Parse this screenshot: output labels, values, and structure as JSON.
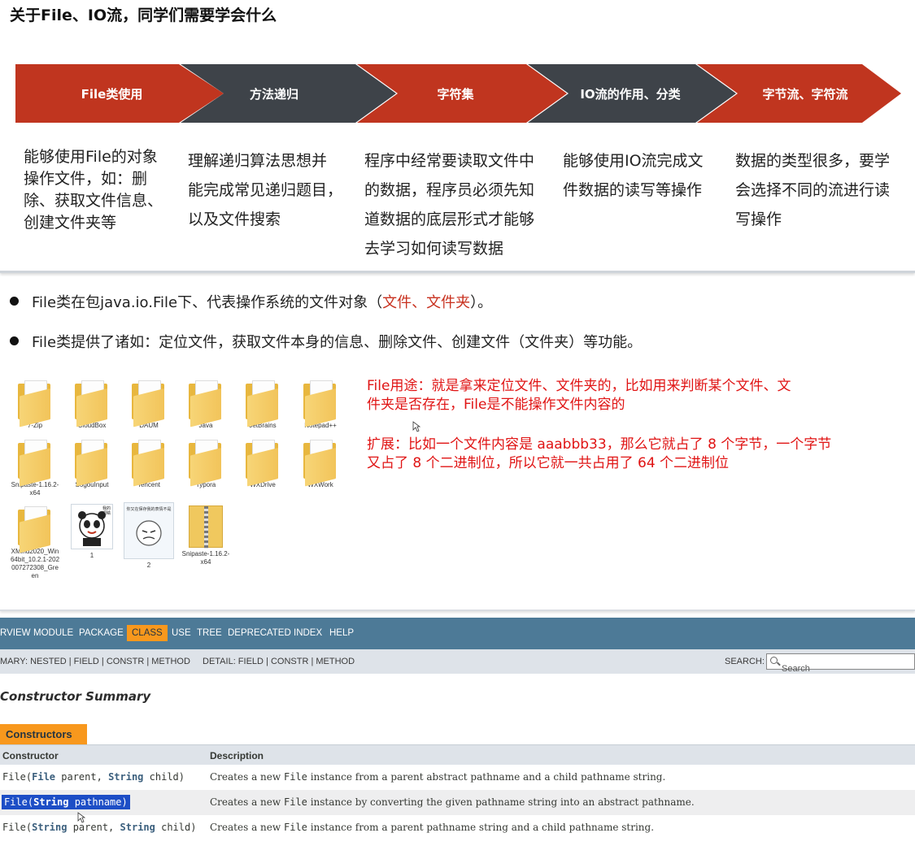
{
  "slide1": {
    "title": "关于File、IO流，同学们需要学会什么",
    "chevrons": [
      {
        "label": "File类使用",
        "color": "#c0351f"
      },
      {
        "label": "方法递归",
        "color": "#3e4349"
      },
      {
        "label": "字符集",
        "color": "#c0351f"
      },
      {
        "label": "IO流的作用、分类",
        "color": "#3e4349"
      },
      {
        "label": "字节流、字符流",
        "color": "#c0351f"
      }
    ],
    "descriptions": [
      [
        "能够使用File的对象",
        "操作文件，如：删",
        "除、获取文件信息、",
        "创建文件夹等"
      ],
      [
        "理解递归算法思想并",
        "能完成常见递归题目，",
        "以及文件搜索"
      ],
      [
        "程序中经常要读取文件中",
        "的数据，程序员必须先知",
        "道数据的底层形式才能够",
        "去学习如何读写数据"
      ],
      [
        "能够使用IO流完成文",
        "件数据的读写等操作"
      ],
      [
        "数据的类型很多，要学",
        "会选择不同的流进行读",
        "写操作"
      ]
    ]
  },
  "slide2": {
    "bullet1_prefix": "File类在包java.io.File下、代表操作系统的文件对象（",
    "bullet1_highlight": "文件、文件夹",
    "bullet1_suffix": "）。",
    "bullet2": "File类提供了诸如：定位文件，获取文件本身的信息、删除文件、创建文件（文件夹）等功能。",
    "files": [
      {
        "name": "7-Zip",
        "kind": "folder"
      },
      {
        "name": "CloudBox",
        "kind": "folder"
      },
      {
        "name": "DAUM",
        "kind": "folder"
      },
      {
        "name": "Java",
        "kind": "folder"
      },
      {
        "name": "JetBrains",
        "kind": "folder"
      },
      {
        "name": "Notepad++",
        "kind": "folder"
      },
      {
        "name": "Snipaste-1.16.2-x64",
        "kind": "folder"
      },
      {
        "name": "SogouInput",
        "kind": "folder"
      },
      {
        "name": "Tencent",
        "kind": "folder"
      },
      {
        "name": "Typora",
        "kind": "folder"
      },
      {
        "name": "WXDrive",
        "kind": "folder"
      },
      {
        "name": "WXWork",
        "kind": "folder"
      },
      {
        "name": "XMind2020_Win64bit_10.2.1-202007272308_Green",
        "kind": "folder"
      },
      {
        "name": "1",
        "kind": "image"
      },
      {
        "name": "2",
        "kind": "image"
      },
      {
        "name": "Snipaste-1.16.2-x64",
        "kind": "zip"
      }
    ],
    "thumb1_text": "我的眼睛",
    "thumb2_text": "你又在保存我的表情不是",
    "note1_line1": "File用途：就是拿来定位文件、文件夹的，比如用来判断某个文件、文",
    "note1_line2": "件夹是否存在，File是不能操作文件内容的",
    "note2_line1": "扩展：比如一个文件内容是 aaabbb33，那么它就占了 8 个字节，一个字节",
    "note2_line2": "又占了 8 个二进制位，所以它就一共占用了 64 个二进制位"
  },
  "javadoc": {
    "topnav": [
      "RVIEW",
      "MODULE",
      "PACKAGE",
      "CLASS",
      "USE",
      "TREE",
      "DEPRECATED",
      "INDEX",
      "HELP"
    ],
    "active_tab": "CLASS",
    "summary_label": "MARY: NESTED | FIELD | CONSTR | METHOD",
    "detail_label": "DETAIL: FIELD | CONSTR | METHOD",
    "search_label": "SEARCH:",
    "search_placeholder": "Search",
    "section_title": "Constructor Summary",
    "caption": "Constructors",
    "col_constructor": "Constructor",
    "col_description": "Description",
    "rows": [
      {
        "sig": [
          "File(",
          "File",
          " parent, ",
          "String",
          " child)"
        ],
        "desc_a": "Creates a new ",
        "desc_code": "File",
        "desc_b": " instance from a parent abstract pathname and a child pathname string."
      },
      {
        "sig": [
          "File(",
          "String",
          " pathname)"
        ],
        "desc_a": "Creates a new ",
        "desc_code": "File",
        "desc_b": " instance by converting the given pathname string into an abstract pathname."
      },
      {
        "sig": [
          "File(",
          "String",
          " parent, ",
          "String",
          " child)"
        ],
        "desc_a": "Creates a new ",
        "desc_code": "File",
        "desc_b": " instance from a parent pathname string and a child pathname string."
      }
    ]
  }
}
